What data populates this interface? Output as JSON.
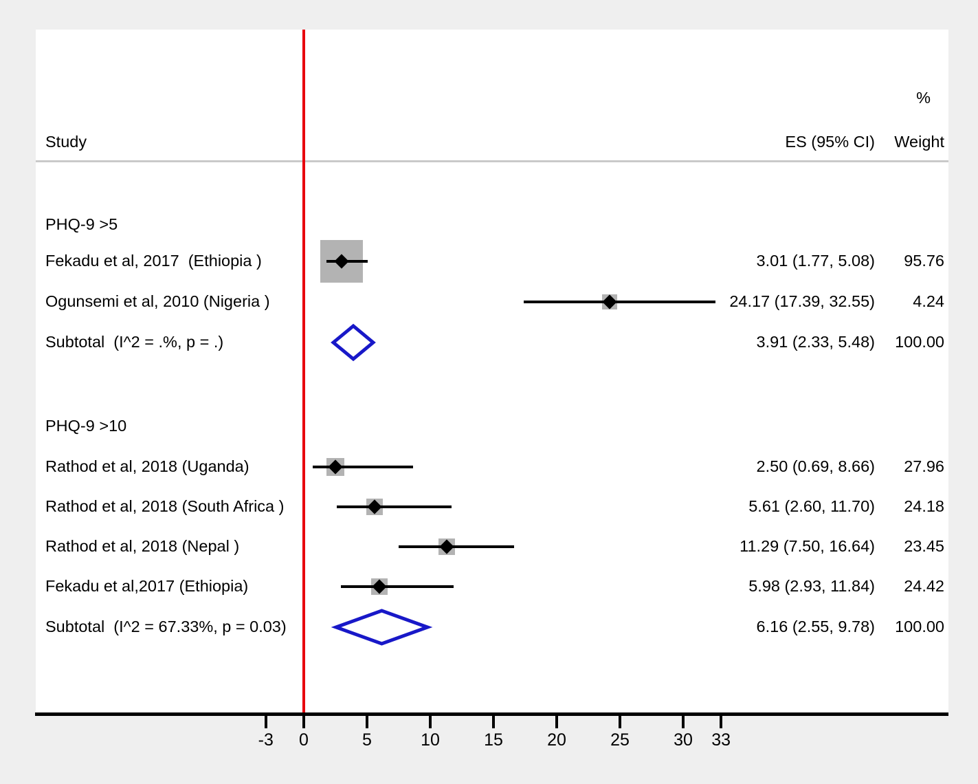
{
  "header": {
    "study_label": "Study",
    "es_label": "ES (95% CI)",
    "weight_pct_symbol": "%",
    "weight_label": "Weight"
  },
  "colors": {
    "null_line": "#e8000d",
    "diamond": "#1818c8",
    "weight_box": "#b3b3b3",
    "marker": "#000000",
    "page_background": "#efefef",
    "plot_background": "#ffffff",
    "header_rule": "#c9c9c9"
  },
  "axis": {
    "ticks": [
      -3,
      0,
      5,
      10,
      15,
      20,
      25,
      30,
      33
    ],
    "tick_labels": [
      "-3",
      "0",
      "5",
      "10",
      "15",
      "20",
      "25",
      "30",
      "33"
    ],
    "min": -5.4,
    "max": 34.5,
    "reference_value": 0
  },
  "chart_data": {
    "type": "forest",
    "title": "",
    "xlabel": "",
    "ylabel": "",
    "xlim": [
      -5.4,
      34.5
    ],
    "grid": false,
    "legend": "none",
    "effect_measure": "ES (95% CI)",
    "reference_line": 0,
    "groups": [
      {
        "label": "PHQ-9 >5",
        "rows": [
          {
            "study": "Fekadu et al, 2017  (Ethiopia )",
            "es": 3.01,
            "ci_low": 1.77,
            "ci_high": 5.08,
            "es_text": "3.01 (1.77, 5.08)",
            "weight": 95.76,
            "weight_text": "95.76"
          },
          {
            "study": "Ogunsemi et al, 2010 (Nigeria )",
            "es": 24.17,
            "ci_low": 17.39,
            "ci_high": 32.55,
            "es_text": "24.17 (17.39, 32.55)",
            "weight": 4.24,
            "weight_text": "4.24"
          }
        ],
        "subtotal": {
          "study": "Subtotal  (I^2 = .%, p = .)",
          "es": 3.91,
          "ci_low": 2.33,
          "ci_high": 5.48,
          "es_text": "3.91 (2.33, 5.48)",
          "weight": 100.0,
          "weight_text": "100.00",
          "i_squared": ".%",
          "p_value": "."
        }
      },
      {
        "label": "PHQ-9 >10",
        "rows": [
          {
            "study": "Rathod et al, 2018 (Uganda)",
            "es": 2.5,
            "ci_low": 0.69,
            "ci_high": 8.66,
            "es_text": "2.50 (0.69, 8.66)",
            "weight": 27.96,
            "weight_text": "27.96"
          },
          {
            "study": "Rathod et al, 2018 (South Africa )",
            "es": 5.61,
            "ci_low": 2.6,
            "ci_high": 11.7,
            "es_text": "5.61 (2.60, 11.70)",
            "weight": 24.18,
            "weight_text": "24.18"
          },
          {
            "study": "Rathod et al, 2018 (Nepal )",
            "es": 11.29,
            "ci_low": 7.5,
            "ci_high": 16.64,
            "es_text": "11.29 (7.50, 16.64)",
            "weight": 23.45,
            "weight_text": "23.45"
          },
          {
            "study": "Fekadu et al,2017 (Ethiopia)",
            "es": 5.98,
            "ci_low": 2.93,
            "ci_high": 11.84,
            "es_text": "5.98 (2.93, 11.84)",
            "weight": 24.42,
            "weight_text": "24.42"
          }
        ],
        "subtotal": {
          "study": "Subtotal  (I^2 = 67.33%, p = 0.03)",
          "es": 6.16,
          "ci_low": 2.55,
          "ci_high": 9.78,
          "es_text": "6.16 (2.55, 9.78)",
          "weight": 100.0,
          "weight_text": "100.00",
          "i_squared": "67.33%",
          "p_value": "0.03"
        }
      }
    ]
  },
  "rows_layout": [
    {
      "key": "group0_label",
      "y": 284
    },
    {
      "key": "g0_r0",
      "y": 337
    },
    {
      "key": "g0_r1",
      "y": 396
    },
    {
      "key": "g0_sub",
      "y": 455
    },
    {
      "key": "group1_label",
      "y": 577
    },
    {
      "key": "g1_r0",
      "y": 636
    },
    {
      "key": "g1_r1",
      "y": 694
    },
    {
      "key": "g1_r2",
      "y": 752
    },
    {
      "key": "g1_r3",
      "y": 810
    },
    {
      "key": "g1_sub",
      "y": 869
    }
  ]
}
